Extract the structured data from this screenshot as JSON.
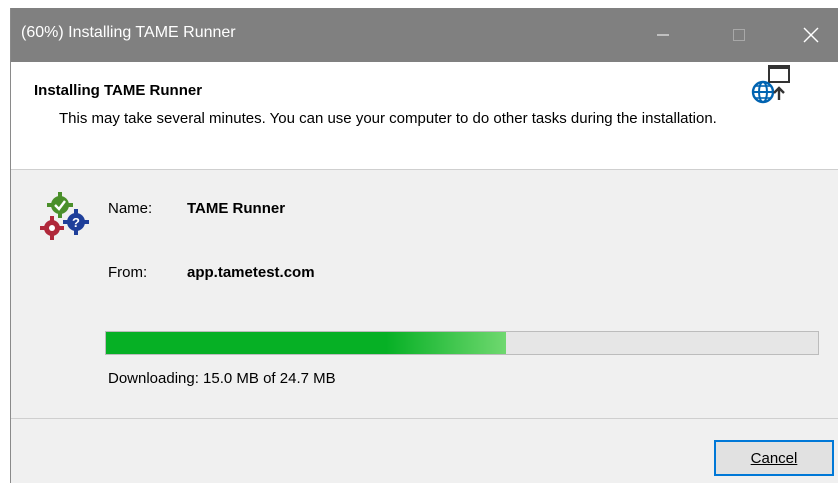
{
  "window": {
    "title": "(60%) Installing TAME Runner"
  },
  "header": {
    "title": "Installing TAME Runner",
    "description": "This may take several minutes. You can use your computer to do other tasks during the installation."
  },
  "app": {
    "name_label": "Name:",
    "name_value": "TAME Runner",
    "from_label": "From:",
    "from_value": "app.tametest.com"
  },
  "progress": {
    "fraction": 0.562,
    "status": "Downloading: 15.0 MB of 24.7 MB"
  },
  "footer": {
    "cancel_label": "Cancel"
  },
  "colors": {
    "titlebar": "#808080",
    "progress_green": "#06b025",
    "accent": "#0078d7"
  },
  "icons": {
    "header": "globe-install-icon",
    "app": "gears-question-icon",
    "minimize": "minimize-icon",
    "maximize": "maximize-icon",
    "close": "close-icon"
  }
}
